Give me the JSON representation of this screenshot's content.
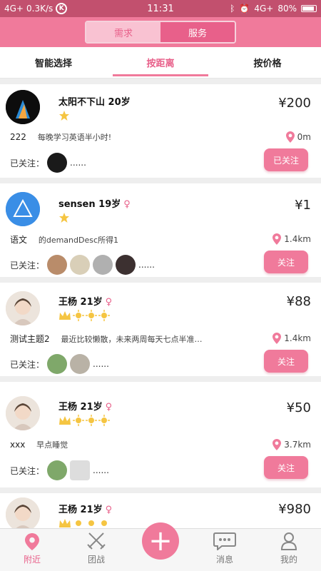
{
  "statusbar": {
    "network_left": "4G+",
    "speed": "0.3K/s",
    "k_icon": "K",
    "time": "11:31",
    "network_right": "4G+",
    "battery": "80%"
  },
  "header": {
    "segments": [
      {
        "label": "需求",
        "active": true
      },
      {
        "label": "服务",
        "active": false
      }
    ]
  },
  "sort_tabs": [
    {
      "label": "智能选择"
    },
    {
      "label": "按距离"
    },
    {
      "label": "按价格"
    }
  ],
  "follow_label": "已关注：",
  "cards": [
    {
      "name": "太阳不下山 20岁",
      "gender": "",
      "price": "¥200",
      "stars": 1,
      "topic": "222",
      "detail": "每晚学习英语半小时!",
      "distance": "0m",
      "followers_more": "......",
      "button": "已关注"
    },
    {
      "name": "sensen 19岁",
      "gender": "♀",
      "price": "¥1",
      "stars": 1,
      "topic": "语文",
      "detail": "的demandDesc所得1",
      "distance": "1.4km",
      "followers_more": "......",
      "button": "关注"
    },
    {
      "name": "王杨 21岁",
      "gender": "♀",
      "price": "¥88",
      "stars": 4,
      "topic": "测试主题2",
      "detail": "最近比较懒散，未来两周每天七点半准…",
      "distance": "1.4km",
      "followers_more": "......",
      "button": "关注"
    },
    {
      "name": "王杨 21岁",
      "gender": "♀",
      "price": "¥50",
      "stars": 4,
      "topic": "xxx",
      "detail": "早点睡觉",
      "distance": "3.7km",
      "followers_more": "......",
      "button": "关注"
    },
    {
      "name": "王杨 21岁",
      "gender": "♀",
      "price": "¥980",
      "stars": 4
    }
  ],
  "bottom_nav": [
    {
      "label": "附近",
      "icon": "location-pin-icon",
      "active": true
    },
    {
      "label": "团战",
      "icon": "crossed-swords-icon",
      "active": false
    },
    {
      "label": "",
      "icon": "plus-icon",
      "active": false
    },
    {
      "label": "消息",
      "icon": "chat-bubble-icon",
      "active": false
    },
    {
      "label": "我的",
      "icon": "person-icon",
      "active": false
    }
  ],
  "colors": {
    "accent": "#f07a9b",
    "accent_dark": "#e8608a",
    "statusbar": "#c2506e",
    "star": "#f5c542"
  }
}
